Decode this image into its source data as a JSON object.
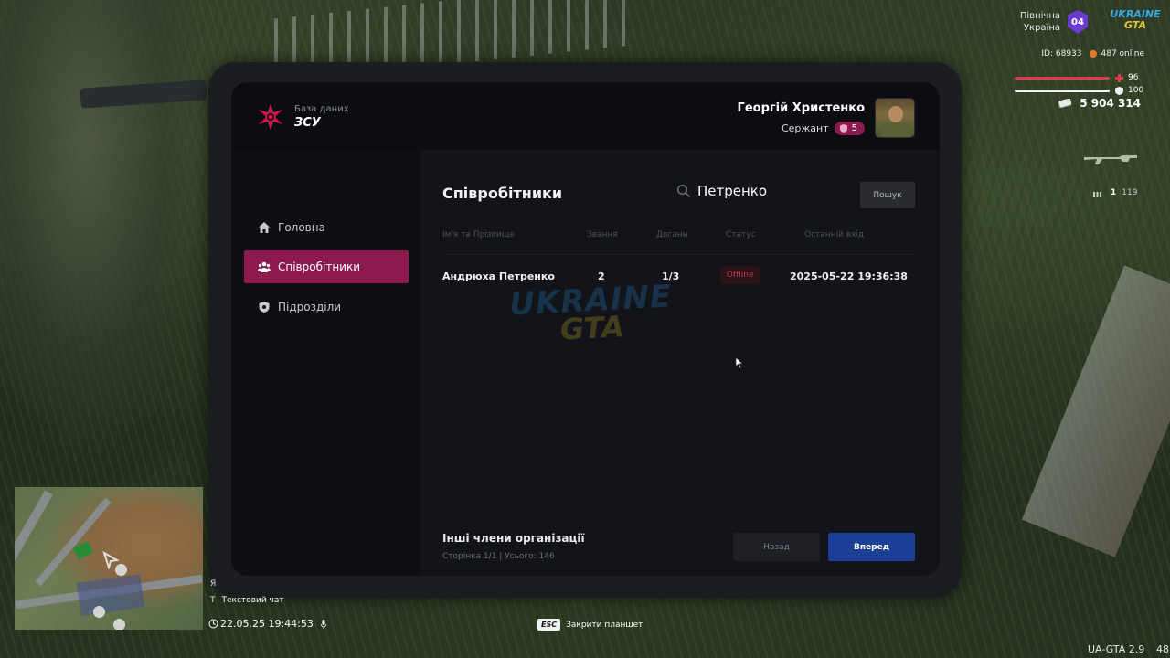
{
  "tablet": {
    "brand": {
      "subtitle": "База даних",
      "title": "ЗСУ"
    },
    "user": {
      "name": "Георгій Христенко",
      "rank": "Сержант",
      "rank_level": "5"
    },
    "sidebar": {
      "items": [
        {
          "label": "Головна",
          "icon": "home-icon",
          "active": false
        },
        {
          "label": "Співробітники",
          "icon": "people-icon",
          "active": true
        },
        {
          "label": "Підрозділи",
          "icon": "shield-icon",
          "active": false
        }
      ]
    },
    "main": {
      "title": "Співробітники",
      "search": {
        "value": "Петренко",
        "button": "Пошук"
      },
      "table": {
        "headers": [
          "Ім'я та Прізвище",
          "Звання",
          "Догани",
          "Статус",
          "Останній вхід"
        ],
        "rows": [
          {
            "name": "Андрюха Петренко",
            "rank": "2",
            "reprimands": "1/3",
            "status": "Offline",
            "last_login": "2025-05-22 19:36:38"
          }
        ]
      },
      "watermark": {
        "line1": "UKRAINE",
        "line2": "GTA"
      },
      "footer": {
        "title": "Інші члени організації",
        "meta": "Сторінка 1/1 | Усього: 146",
        "back": "Назад",
        "next": "Вперед"
      }
    }
  },
  "hud": {
    "region_line1": "Північна",
    "region_line2": "Україна",
    "region_badge": "04",
    "logo_line1": "UKRAINE",
    "logo_line2": "GTA",
    "player_id": "ID: 68933",
    "online": "487 online",
    "health": "96",
    "armor": "100",
    "money": "5 904 314",
    "ammo_clip": "1",
    "ammo_total": "119",
    "health_color": "#e23a4d",
    "accent_color": "#8c1a4f",
    "primary_button_color": "#1a3f94"
  },
  "bottom": {
    "scroll_key": "Я",
    "chat_key": "T",
    "chat_label": "Текстовий чат",
    "datetime": "22.05.25 19:44:53",
    "esc_key": "ESC",
    "esc_label": "Закрити планшет",
    "version": "UA-GTA 2.9",
    "fps": "48"
  }
}
